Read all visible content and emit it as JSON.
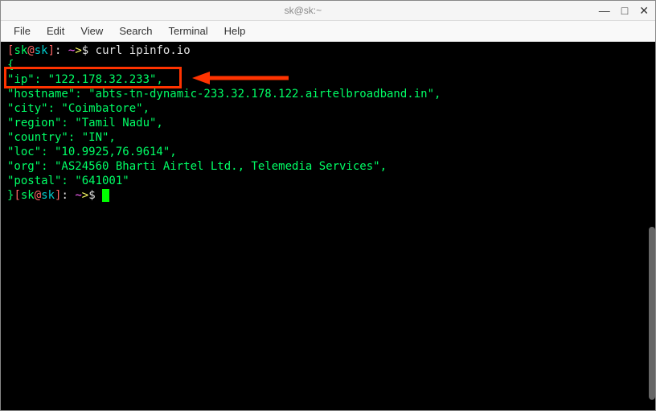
{
  "window": {
    "title": "sk@sk:~"
  },
  "menus": {
    "file": "File",
    "edit": "Edit",
    "view": "View",
    "search": "Search",
    "terminal": "Terminal",
    "help": "Help"
  },
  "prompt": {
    "user": "sk",
    "host": "sk",
    "path": "~",
    "arrow": ">",
    "dollar": "$"
  },
  "command": "curl ipinfo.io",
  "response": {
    "open": "{",
    "close": "}",
    "ip_line": "  \"ip\": \"122.178.32.233\",",
    "hostname_line": "  \"hostname\": \"abts-tn-dynamic-233.32.178.122.airtelbroadband.in\",",
    "city_line": "  \"city\": \"Coimbatore\",",
    "region_line": "  \"region\": \"Tamil Nadu\",",
    "country_line": "  \"country\": \"IN\",",
    "loc_line": "  \"loc\": \"10.9925,76.9614\",",
    "org_line": "  \"org\": \"AS24560 Bharti Airtel Ltd., Telemedia Services\",",
    "postal_line": "  \"postal\": \"641001\""
  }
}
